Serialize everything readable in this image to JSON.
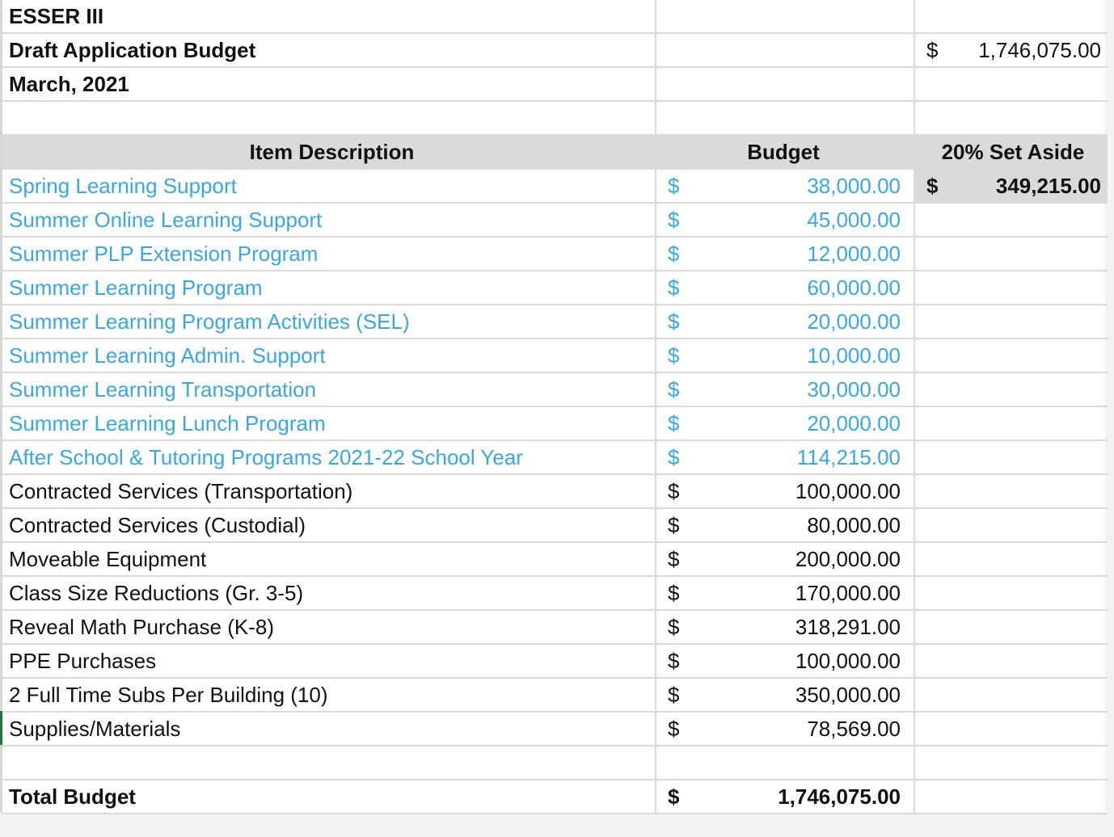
{
  "header": {
    "title": "ESSER III",
    "subtitle": "Draft Application Budget",
    "date": "March, 2021",
    "top_total_currency": "$",
    "top_total_value": "1,746,075.00"
  },
  "columns": {
    "description": "Item Description",
    "budget": "Budget",
    "set_aside": "20% Set Aside"
  },
  "set_aside": {
    "currency": "$",
    "value": "349,215.00"
  },
  "colors": {
    "set_aside_items": "#3aa7e4",
    "header_fill": "#dadada"
  },
  "items": [
    {
      "description": "Spring Learning Support",
      "currency": "$",
      "amount": "38,000.00",
      "set_aside": true
    },
    {
      "description": "Summer Online Learning Support",
      "currency": "$",
      "amount": "45,000.00",
      "set_aside": true
    },
    {
      "description": "Summer PLP Extension Program",
      "currency": "$",
      "amount": "12,000.00",
      "set_aside": true
    },
    {
      "description": "Summer Learning Program",
      "currency": "$",
      "amount": "60,000.00",
      "set_aside": true
    },
    {
      "description": "Summer Learning Program Activities (SEL)",
      "currency": "$",
      "amount": "20,000.00",
      "set_aside": true
    },
    {
      "description": "Summer Learning Admin. Support",
      "currency": "$",
      "amount": "10,000.00",
      "set_aside": true
    },
    {
      "description": "Summer Learning Transportation",
      "currency": "$",
      "amount": "30,000.00",
      "set_aside": true
    },
    {
      "description": "Summer Learning Lunch Program",
      "currency": "$",
      "amount": "20,000.00",
      "set_aside": true
    },
    {
      "description": "After School & Tutoring Programs 2021-22 School Year",
      "currency": "$",
      "amount": "114,215.00",
      "set_aside": true
    },
    {
      "description": "Contracted Services (Transportation)",
      "currency": "$",
      "amount": "100,000.00",
      "set_aside": false
    },
    {
      "description": "Contracted Services (Custodial)",
      "currency": "$",
      "amount": "80,000.00",
      "set_aside": false
    },
    {
      "description": "Moveable Equipment",
      "currency": "$",
      "amount": "200,000.00",
      "set_aside": false
    },
    {
      "description": "Class Size Reductions (Gr. 3-5)",
      "currency": "$",
      "amount": "170,000.00",
      "set_aside": false
    },
    {
      "description": "Reveal Math Purchase (K-8)",
      "currency": "$",
      "amount": "318,291.00",
      "set_aside": false
    },
    {
      "description": "PPE Purchases",
      "currency": "$",
      "amount": "100,000.00",
      "set_aside": false
    },
    {
      "description": "2 Full Time Subs Per Building (10)",
      "currency": "$",
      "amount": "350,000.00",
      "set_aside": false
    },
    {
      "description": "Supplies/Materials",
      "currency": "$",
      "amount": "78,569.00",
      "set_aside": false
    }
  ],
  "total": {
    "label": "Total Budget",
    "currency": "$",
    "value": "1,746,075.00"
  }
}
